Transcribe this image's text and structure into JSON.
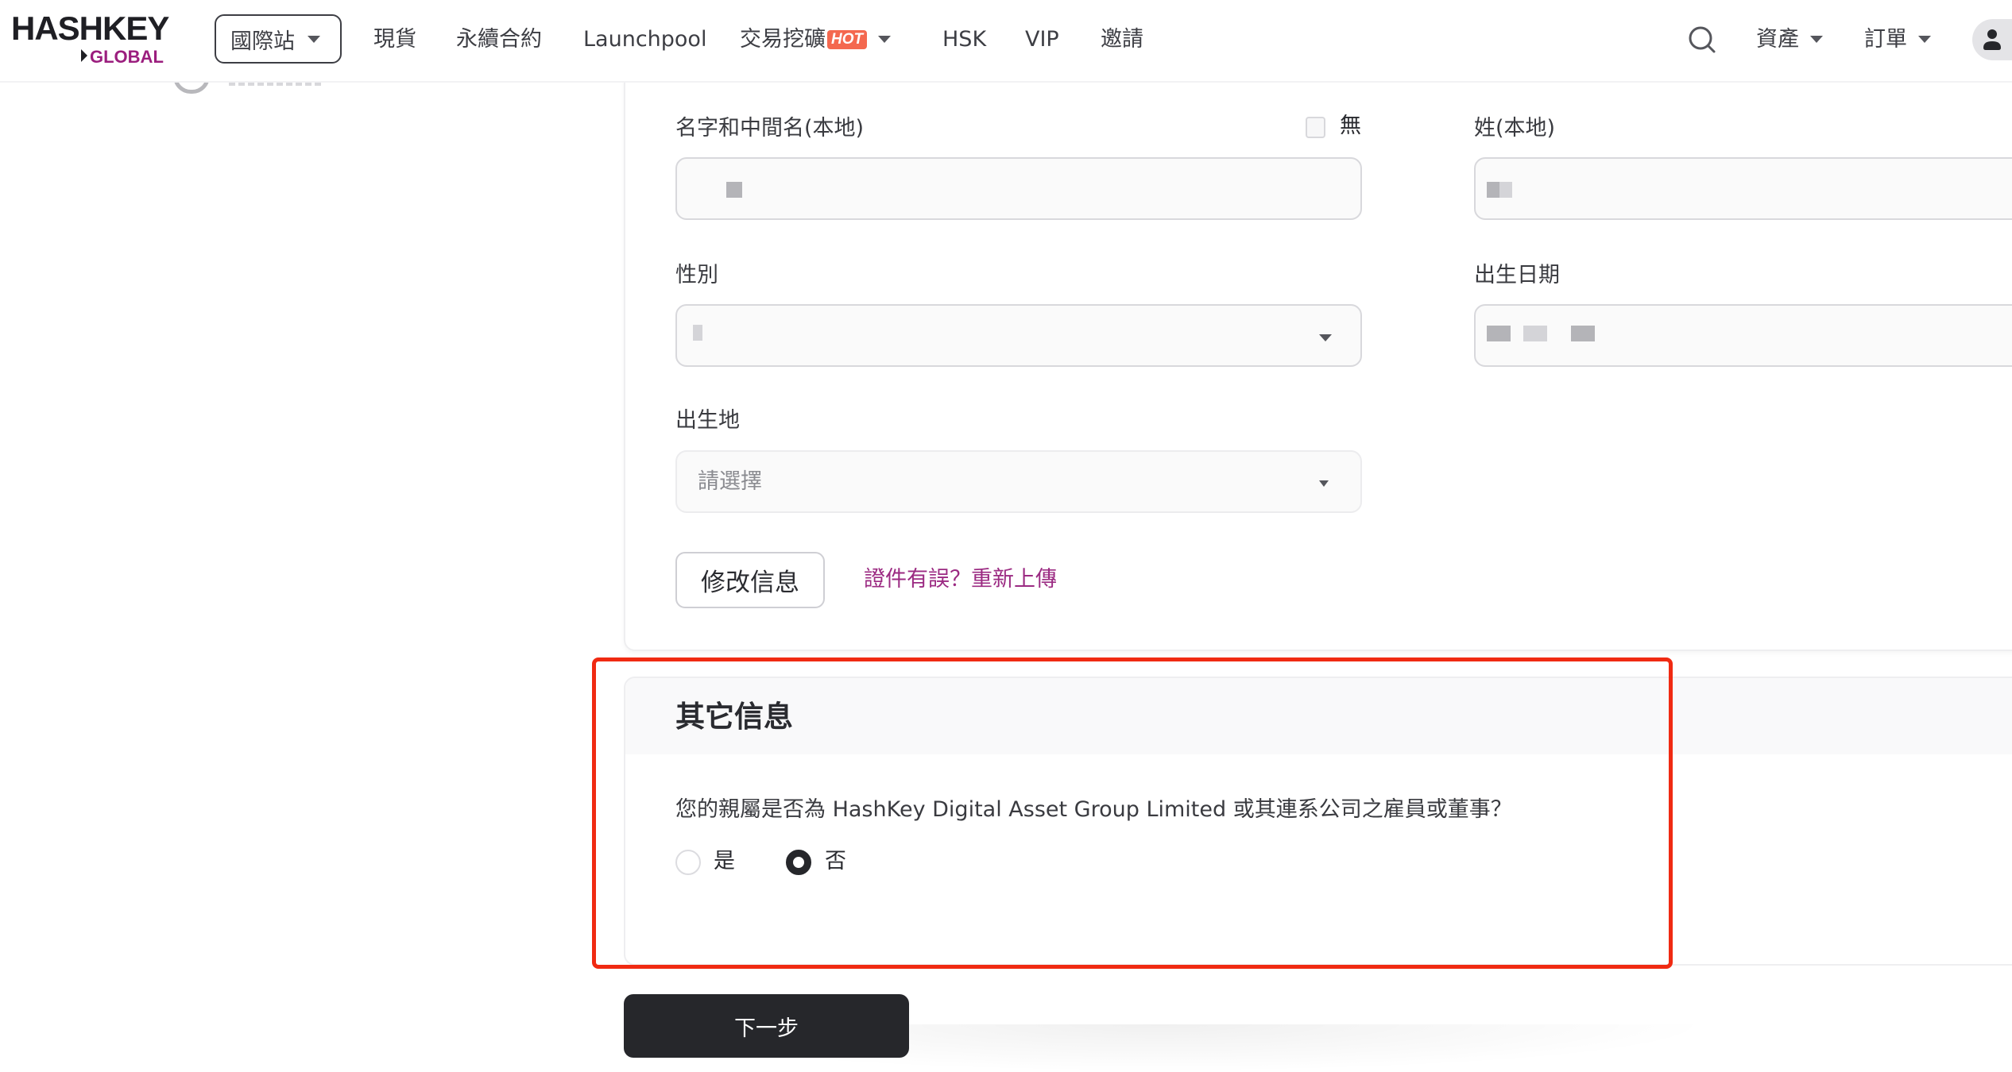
{
  "header": {
    "logo": {
      "main": "HASHKEY",
      "sub": "GLOBAL"
    },
    "site_selector": {
      "label": "國際站"
    },
    "nav": [
      {
        "label": "現貨"
      },
      {
        "label": "永續合約"
      },
      {
        "label": "Launchpool"
      },
      {
        "label": "交易挖礦",
        "badge": "HOT",
        "has_dropdown": true
      },
      {
        "label": "HSK"
      },
      {
        "label": "VIP"
      },
      {
        "label": "邀請"
      }
    ],
    "right": {
      "search_icon": "search-icon",
      "assets": "資產",
      "orders": "訂單",
      "avatar_icon": "user-icon"
    }
  },
  "personal_info": {
    "first_middle_name": {
      "label": "名字和中間名(本地)",
      "value": "",
      "none_checkbox": {
        "label": "無",
        "checked": false
      }
    },
    "last_name": {
      "label": "姓(本地)",
      "value": ""
    },
    "gender": {
      "label": "性別",
      "value": ""
    },
    "birth_date": {
      "label": "出生日期",
      "value": ""
    },
    "birth_place": {
      "label": "出生地",
      "placeholder": "請選擇"
    },
    "edit_button": "修改信息",
    "reupload_link": "證件有誤？重新上傳"
  },
  "other_info": {
    "title": "其它信息",
    "question": "您的親屬是否為 HashKey Digital Asset Group Limited 或其連系公司之雇員或董事？",
    "options": [
      {
        "label": "是",
        "selected": false
      },
      {
        "label": "否",
        "selected": true
      }
    ]
  },
  "next_button": "下一步",
  "colors": {
    "brand": "#9b1e7e",
    "primary_button": "#26272b",
    "hot_badge": "#f4684f",
    "highlight": "#f02a12",
    "link": "#9b2a82"
  }
}
